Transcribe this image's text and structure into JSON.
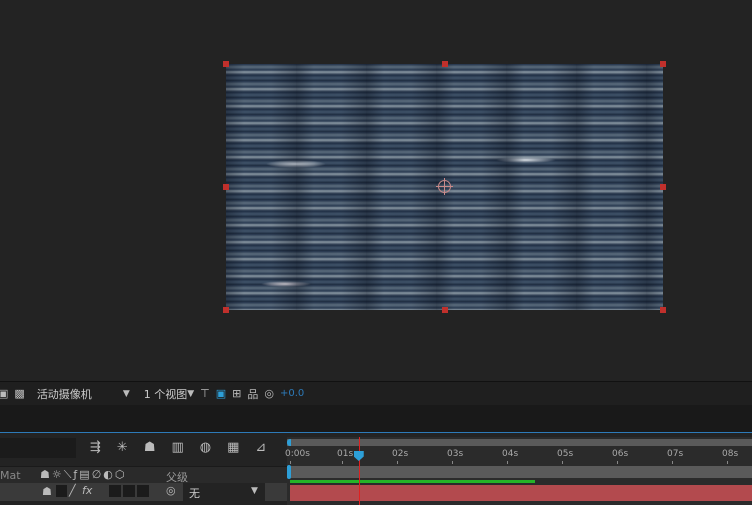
{
  "viewer": {
    "camera_select": "活动摄像机",
    "views_select": "1 个视图",
    "exposure": "+0.0"
  },
  "timeline": {
    "ticks": [
      "0:00s",
      "01s",
      "02s",
      "03s",
      "04s",
      "05s",
      "06s",
      "07s",
      "08s"
    ],
    "column_mat": "Mat",
    "column_parent": "父级",
    "parent_value": "无",
    "playhead_seconds": 1.25,
    "work_area_end_seconds": 4.45
  },
  "colors": {
    "layer_bar": "#b34a4e",
    "work_area": "#27b327",
    "playhead": "#e02020",
    "accent": "#2d9fd8"
  }
}
